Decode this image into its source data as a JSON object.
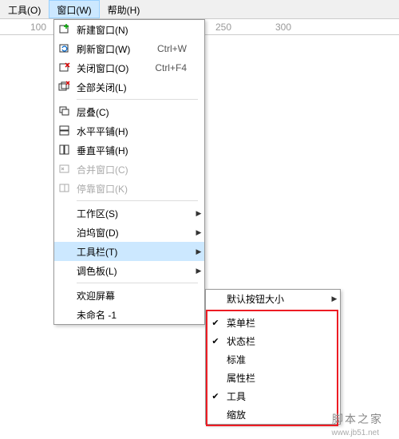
{
  "menubar": {
    "tools": "工具(O)",
    "window": "窗口(W)",
    "help": "帮助(H)"
  },
  "ruler": {
    "t100": "100",
    "t250": "250",
    "t300": "300"
  },
  "menu": {
    "new": "新建窗口(N)",
    "refresh": "刷新窗口(W)",
    "refresh_sc": "Ctrl+W",
    "close": "关闭窗口(O)",
    "close_sc": "Ctrl+F4",
    "closeall": "全部关闭(L)",
    "cascade": "层叠(C)",
    "tileh": "水平平铺(H)",
    "tilev": "垂直平铺(H)",
    "combine": "合并窗口(C)",
    "dock": "停靠窗口(K)",
    "workspace": "工作区(S)",
    "dockers": "泊坞窗(D)",
    "toolbars": "工具栏(T)",
    "palettes": "调色板(L)",
    "welcome": "欢迎屏幕",
    "unnamed": "未命名 -1"
  },
  "sub": {
    "defsize": "默认按钮大小",
    "menubar": "菜单栏",
    "statusbar": "状态栏",
    "standard": "标准",
    "propbar": "属性栏",
    "tools": "工具",
    "zoom": "缩放"
  },
  "wm": {
    "text": "脚本之家",
    "url": "www.jb51.net"
  }
}
